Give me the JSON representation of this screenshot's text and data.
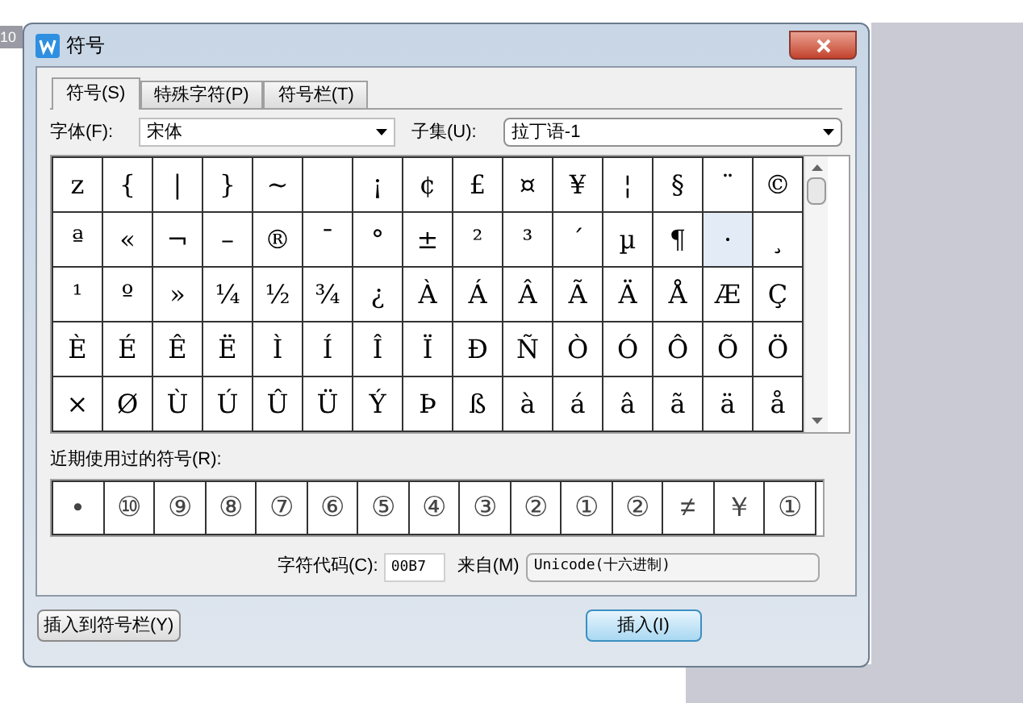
{
  "background": {
    "corner_label": "10"
  },
  "window": {
    "title": "符号"
  },
  "tabs": [
    {
      "label": "符号(S)",
      "selected": true
    },
    {
      "label": "特殊字符(P)",
      "selected": false
    },
    {
      "label": "符号栏(T)",
      "selected": false
    }
  ],
  "font": {
    "label": "字体(F):",
    "value": "宋体"
  },
  "subset": {
    "label": "子集(U):",
    "value": "拉丁语-1"
  },
  "grid": {
    "rows": [
      [
        {
          "char": "z",
          "selected": false
        },
        {
          "char": "{",
          "selected": false
        },
        {
          "char": "|",
          "selected": false
        },
        {
          "char": "}",
          "selected": false
        },
        {
          "char": "~",
          "selected": false
        },
        {
          "selected": false
        },
        {
          "char": "¡",
          "selected": false
        },
        {
          "char": "¢",
          "selected": false
        },
        {
          "char": "£",
          "selected": false
        },
        {
          "char": "¤",
          "selected": false
        },
        {
          "char": "¥",
          "selected": false
        },
        {
          "char": "¦",
          "selected": false
        },
        {
          "char": "§",
          "selected": false
        },
        {
          "char": "¨",
          "selected": false
        },
        {
          "char": "©",
          "selected": false
        }
      ],
      [
        {
          "char": "ª",
          "selected": false
        },
        {
          "char": "«",
          "selected": false
        },
        {
          "char": "¬",
          "selected": false
        },
        {
          "char": "–",
          "selected": false
        },
        {
          "char": "®",
          "selected": false
        },
        {
          "char": "¯",
          "selected": false
        },
        {
          "char": "°",
          "selected": false
        },
        {
          "char": "±",
          "selected": false
        },
        {
          "char": "²",
          "selected": false
        },
        {
          "char": "³",
          "selected": false
        },
        {
          "char": "´",
          "selected": false
        },
        {
          "char": "µ",
          "selected": false
        },
        {
          "char": "¶",
          "selected": false
        },
        {
          "char": "·",
          "selected": true
        },
        {
          "char": "¸",
          "selected": false
        }
      ],
      [
        {
          "char": "¹",
          "selected": false
        },
        {
          "char": "º",
          "selected": false
        },
        {
          "char": "»",
          "selected": false
        },
        {
          "char": "¼",
          "selected": false
        },
        {
          "char": "½",
          "selected": false
        },
        {
          "char": "¾",
          "selected": false
        },
        {
          "char": "¿",
          "selected": false
        },
        {
          "char": "À",
          "selected": false
        },
        {
          "char": "Á",
          "selected": false
        },
        {
          "char": "Â",
          "selected": false
        },
        {
          "char": "Ã",
          "selected": false
        },
        {
          "char": "Ä",
          "selected": false
        },
        {
          "char": "Å",
          "selected": false
        },
        {
          "char": "Æ",
          "selected": false
        },
        {
          "char": "Ç",
          "selected": false
        }
      ],
      [
        {
          "char": "È",
          "selected": false
        },
        {
          "char": "É",
          "selected": false
        },
        {
          "char": "Ê",
          "selected": false
        },
        {
          "char": "Ë",
          "selected": false
        },
        {
          "char": "Ì",
          "selected": false
        },
        {
          "char": "Í",
          "selected": false
        },
        {
          "char": "Î",
          "selected": false
        },
        {
          "char": "Ï",
          "selected": false
        },
        {
          "char": "Ð",
          "selected": false
        },
        {
          "char": "Ñ",
          "selected": false
        },
        {
          "char": "Ò",
          "selected": false
        },
        {
          "char": "Ó",
          "selected": false
        },
        {
          "char": "Ô",
          "selected": false
        },
        {
          "char": "Õ",
          "selected": false
        },
        {
          "char": "Ö",
          "selected": false
        }
      ],
      [
        {
          "char": "×",
          "selected": false
        },
        {
          "char": "Ø",
          "selected": false
        },
        {
          "char": "Ù",
          "selected": false
        },
        {
          "char": "Ú",
          "selected": false
        },
        {
          "char": "Û",
          "selected": false
        },
        {
          "char": "Ü",
          "selected": false
        },
        {
          "char": "Ý",
          "selected": false
        },
        {
          "char": "Þ",
          "selected": false
        },
        {
          "char": "ß",
          "selected": false
        },
        {
          "char": "à",
          "selected": false
        },
        {
          "char": "á",
          "selected": false
        },
        {
          "char": "â",
          "selected": false
        },
        {
          "char": "ã",
          "selected": false
        },
        {
          "char": "ä",
          "selected": false
        },
        {
          "char": "å",
          "selected": false
        }
      ]
    ]
  },
  "recent": {
    "label": "近期使用过的符号(R):",
    "items": [
      "•",
      "⑩",
      "⑨",
      "⑧",
      "⑦",
      "⑥",
      "⑤",
      "④",
      "③",
      "②",
      "①",
      "②",
      "≠",
      "￥",
      "①"
    ]
  },
  "char_code": {
    "label": "字符代码(C):",
    "value": "00B7"
  },
  "from": {
    "label": "来自(M)",
    "value": "Unicode(十六进制)"
  },
  "buttons": [
    {
      "kind": "insert_to_bar",
      "label": "插入到符号栏(Y)"
    },
    {
      "kind": "insert",
      "label": "插入(I)"
    }
  ]
}
